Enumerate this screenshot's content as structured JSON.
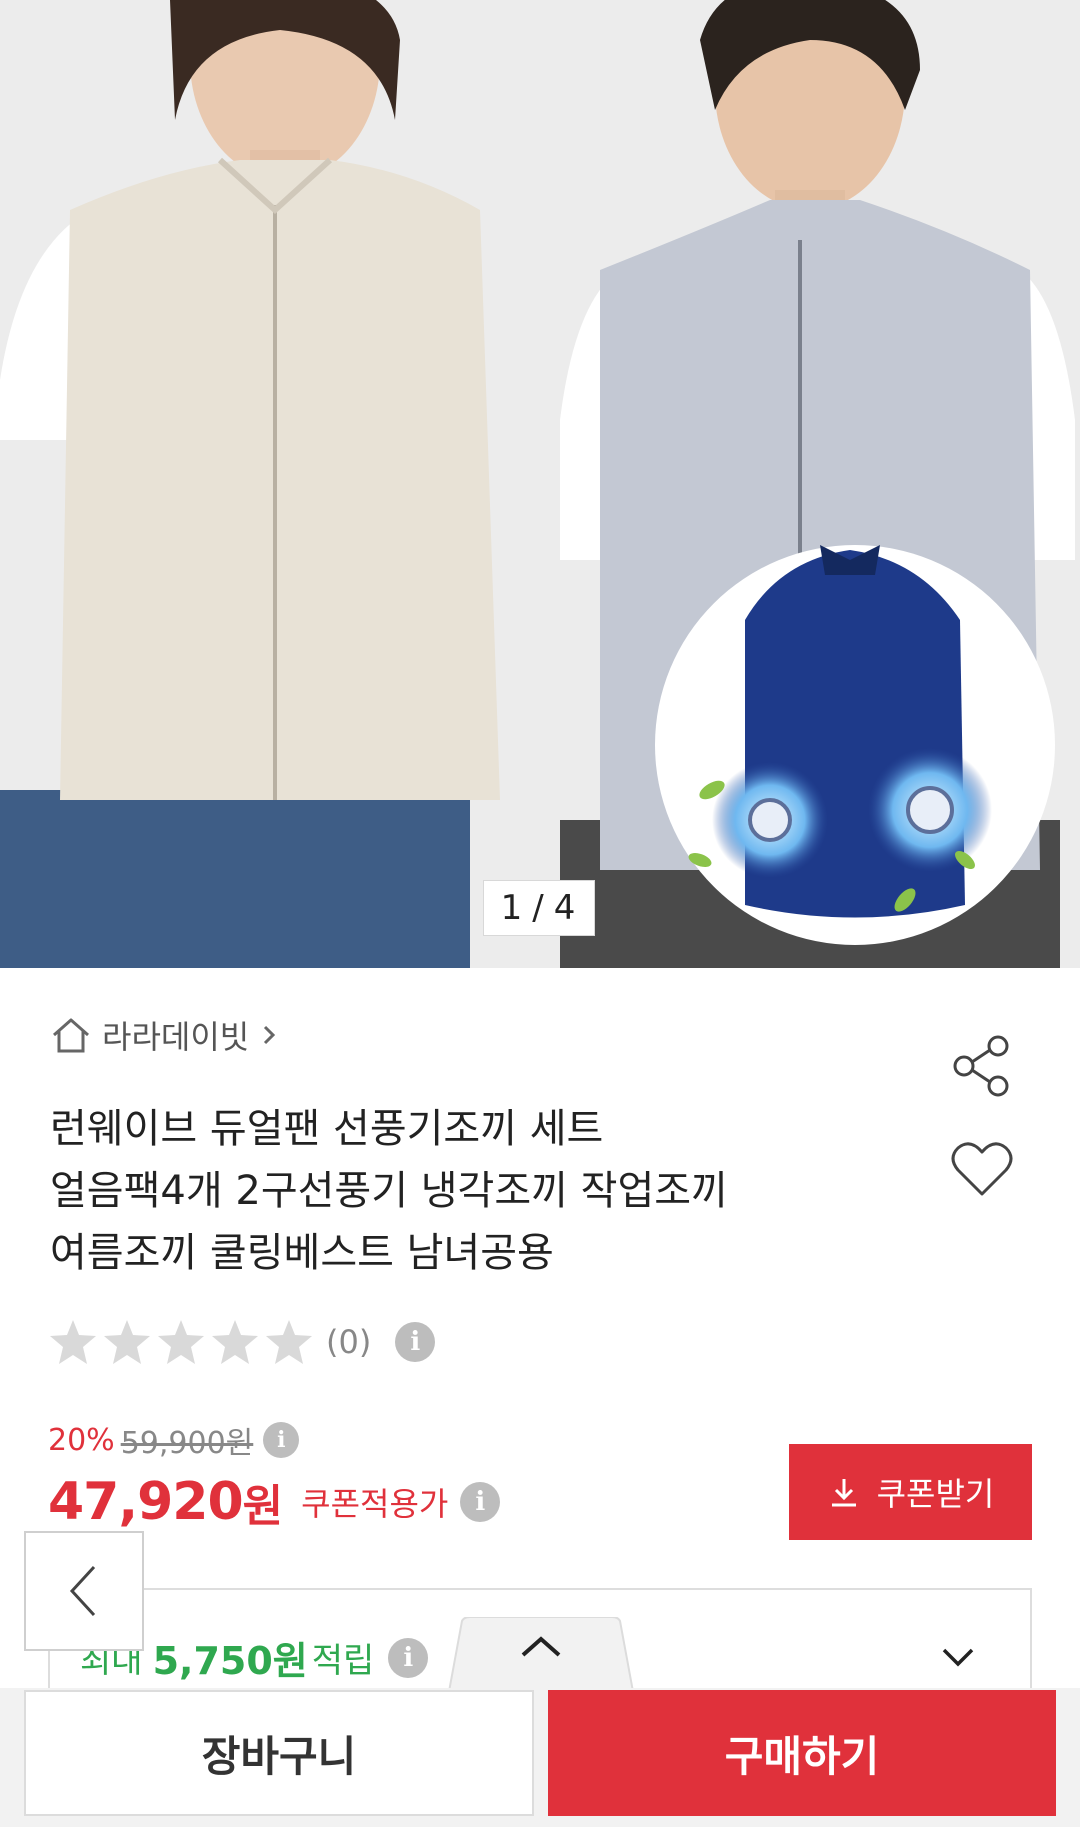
{
  "gallery": {
    "current": "1",
    "separator": "/",
    "total": "4",
    "image_description": "product-photo-cooling-vest"
  },
  "store": {
    "icon": "home-icon",
    "name": "라라데이빗",
    "chevron": "chevron-right-icon"
  },
  "actions": {
    "share_icon": "share-icon",
    "wish_icon": "heart-icon"
  },
  "product": {
    "title_line1": "런웨이브 듀얼팬 선풍기조끼 세트",
    "title_line2": "얼음팩4개 2구선풍기 냉각조끼 작업조끼",
    "title_line3": "여름조끼 쿨링베스트 남녀공용"
  },
  "rating": {
    "stars": 0,
    "max_stars": 5,
    "review_count": "(0)"
  },
  "pricing": {
    "discount_rate": "20%",
    "original_price": "59,900원",
    "sale_price": "47,920",
    "sale_unit": "원",
    "coupon_label": "쿠폰적용가",
    "coupon_button": "쿠폰받기",
    "accent_color": "#e0313b"
  },
  "points": {
    "prefix": "최대",
    "amount": "5,750원",
    "suffix": "적립",
    "color": "#2fa84f"
  },
  "bottom": {
    "cart_label": "장바구니",
    "buy_label": "구매하기"
  }
}
